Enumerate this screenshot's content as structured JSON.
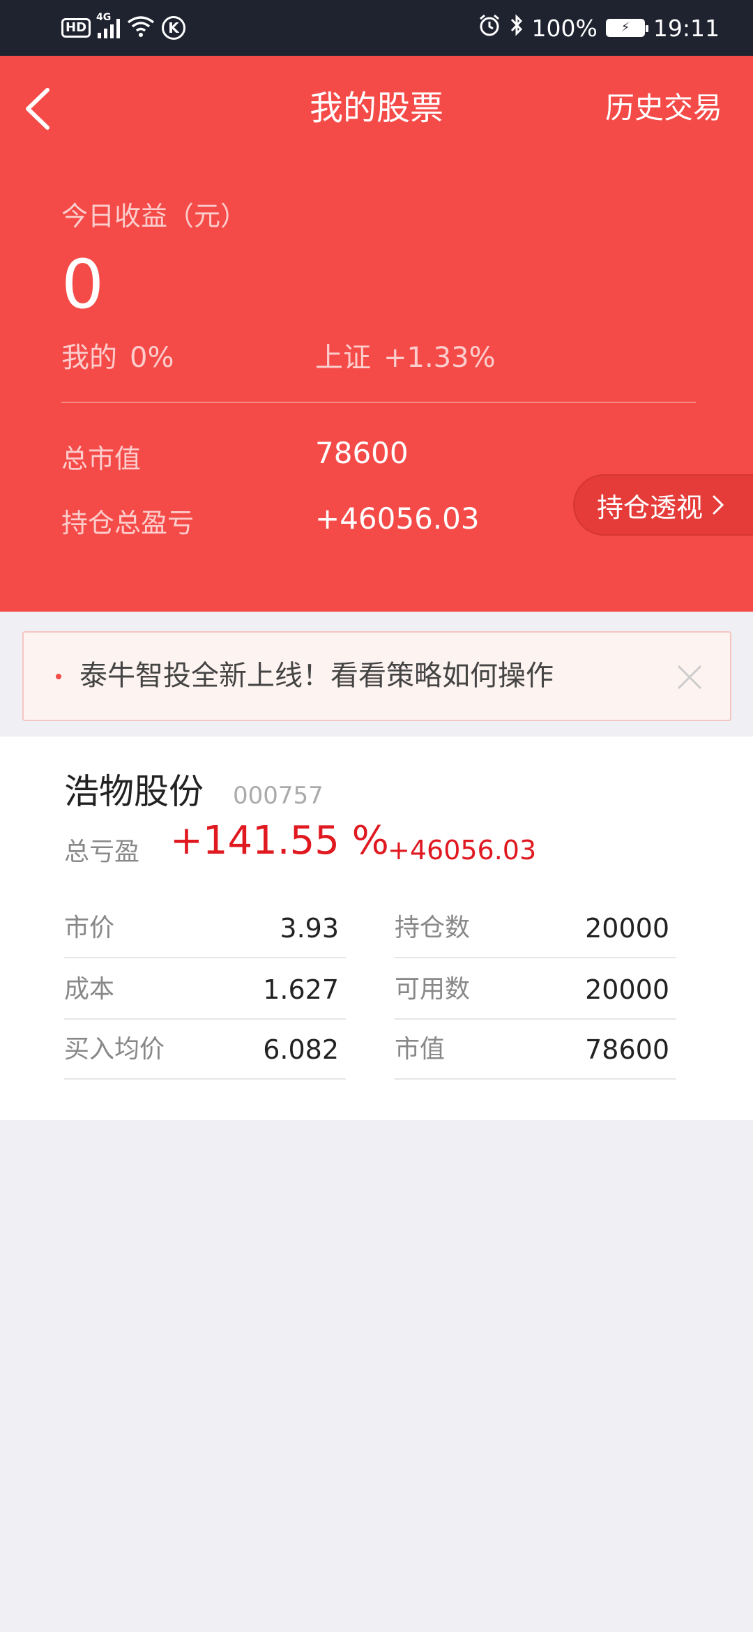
{
  "status_bar": {
    "network_badge": "HD",
    "network_type": "4G",
    "carrier_badge": "K",
    "battery": "100%",
    "time": "19:11",
    "icons": [
      "hd-icon",
      "signal-icon",
      "wifi-icon",
      "k-icon",
      "alarm-icon",
      "bluetooth-icon",
      "battery-icon"
    ]
  },
  "header": {
    "title": "我的股票",
    "history_label": "历史交易"
  },
  "summary": {
    "today_label": "今日收益（元）",
    "today_value": "0",
    "mine_label": "我的",
    "mine_value": "0%",
    "index_label": "上证",
    "index_value": "+1.33%",
    "market_value_label": "总市值",
    "market_value": "78600",
    "total_pl_label": "持仓总盈亏",
    "total_pl": "+46056.03",
    "insight_button": "持仓透视"
  },
  "banner": {
    "text": "泰牛智投全新上线！看看策略如何操作"
  },
  "holding": {
    "name": "浩物股份",
    "code": "000757",
    "pl_label": "总亏盈",
    "pl_percent": "+141.55 %",
    "pl_amount": "+46056.03",
    "left_rows": [
      {
        "label": "市价",
        "value": "3.93"
      },
      {
        "label": "成本",
        "value": "1.627"
      },
      {
        "label": "买入均价",
        "value": "6.082"
      }
    ],
    "right_rows": [
      {
        "label": "持仓数",
        "value": "20000"
      },
      {
        "label": "可用数",
        "value": "20000"
      },
      {
        "label": "市值",
        "value": "78600"
      }
    ]
  },
  "colors": {
    "hero": "#f44b48",
    "status_bar": "#1f2330",
    "gain_text": "#e0181f",
    "page_bg": "#efeff4"
  }
}
